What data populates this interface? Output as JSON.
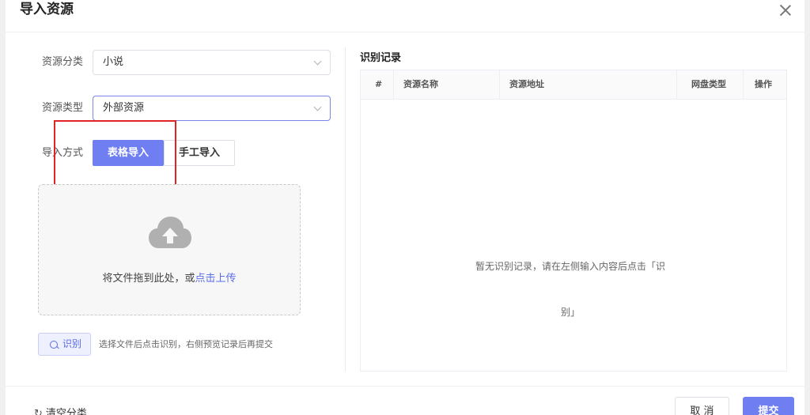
{
  "dialog": {
    "title": "导入资源"
  },
  "form": {
    "category_label": "资源分类",
    "category_value": "小说",
    "type_label": "资源类型",
    "type_value": "外部资源",
    "import_label": "导入方式",
    "import_options": [
      "表格导入",
      "手工导入"
    ],
    "import_selected": "表格导入",
    "upload": {
      "text": "将文件拖到此处，或",
      "link": "点击上传"
    },
    "recognize_button": "识别",
    "recognize_hint": "选择文件后点击识别，右侧预览记录后再提交"
  },
  "records": {
    "title": "识别记录",
    "columns": [
      "#",
      "资源名称",
      "资源地址",
      "网盘类型",
      "操作"
    ],
    "rows": [],
    "empty_text_line1": "暂无识别记录，请在左侧输入内容后点击「识",
    "empty_text_line2": "别」"
  },
  "footer": {
    "clear_label": "清空分类",
    "cancel_label": "取 消",
    "submit_label": "提交"
  },
  "colors": {
    "primary": "#6f7ef0",
    "link": "#5b6ee8",
    "annotation": "#e02424"
  },
  "icons": [
    "close-icon",
    "chevron-down-icon",
    "cloud-upload-icon",
    "search-icon",
    "refresh-icon"
  ]
}
